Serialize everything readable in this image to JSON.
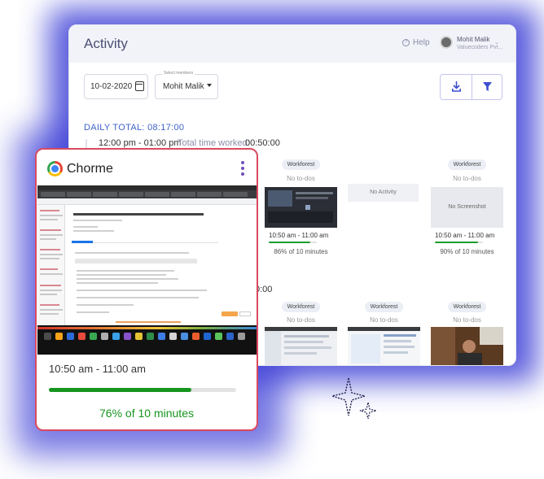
{
  "app": {
    "title": "Activity",
    "help_label": "Help",
    "user_name": "Mohit Malik",
    "user_org": "Valuecoders Pvt...",
    "date_value": "10-02-2020",
    "members_legend": "Select members",
    "members_value": "Mohit Malik",
    "daily_total": "DAILY TOTAL: 08:17:00",
    "slot1": {
      "time": "12:00 pm - 01:00 pm",
      "label": "Total time worked:",
      "worked": "00:50:00"
    },
    "slot2_time_partial": "0:00",
    "no_activity": "No Activity",
    "tiles_row1": [
      {
        "app": "Workforest",
        "todo": "No to-dos",
        "time": "10:50 am - 11:00 am",
        "progress": 0.86,
        "pct": "86% of 10 minutes",
        "shot": "dark"
      },
      {
        "app": "Workforest",
        "todo": "No to-dos",
        "time": "10:50 am - 11:00 am",
        "progress": 0.9,
        "pct": "90% of 10 minutes",
        "shot": "No Screenshot"
      }
    ],
    "tiles_row2": [
      {
        "app": "Workforest",
        "todo": "No to-dos"
      },
      {
        "app": "Workforest",
        "todo": "No to-dos"
      },
      {
        "app": "Workforest",
        "todo": "No to-dos"
      }
    ]
  },
  "card": {
    "title": "Chorme",
    "time": "10:50 am - 11:00 am",
    "progress": 0.76,
    "pct": "76% of 10 minutes"
  },
  "colors": {
    "accent": "#3d3fd6",
    "progress": "#17951f",
    "card_border": "#d94a5e",
    "link": "#3f63c9"
  }
}
